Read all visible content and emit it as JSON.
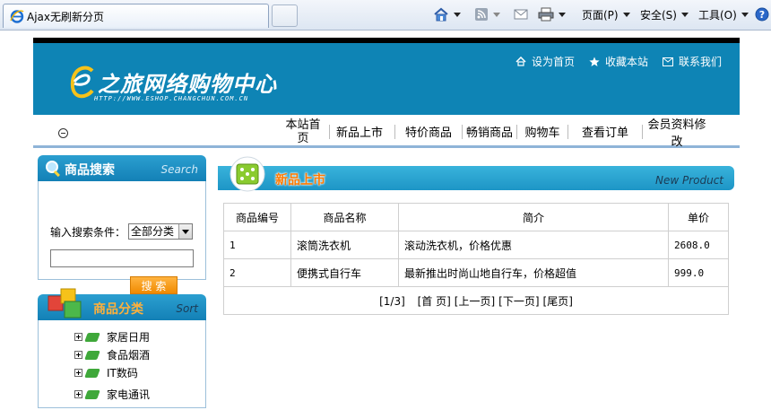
{
  "browser": {
    "tab_title": "Ajax无刷新分页",
    "toolbar": {
      "page_label": "页面(P)",
      "safety_label": "安全(S)",
      "tools_label": "工具(O)"
    }
  },
  "header": {
    "logo_text": "之旅网络购物中心",
    "logo_url": "HTTP://WWW.ESHOP.CHANGCHUN.COM.CN",
    "quick_links": [
      "设为首页",
      "收藏本站",
      "联系我们"
    ]
  },
  "nav": {
    "items": [
      "本站首页",
      "新品上市",
      "特价商品",
      "畅销商品",
      "购物车",
      "查看订单",
      "会员资料修改"
    ]
  },
  "search": {
    "title": "商品搜索",
    "title_en": "Search",
    "label": "输入搜索条件：",
    "select_value": "全部分类",
    "input_value": "",
    "button": "搜 索"
  },
  "categories": {
    "title": "商品分类",
    "title_en": "Sort",
    "items": [
      "家居日用",
      "食品烟酒",
      "IT数码",
      "家电通讯"
    ]
  },
  "products": {
    "title": "新品上市",
    "title_en": "New Product",
    "columns": [
      "商品编号",
      "商品名称",
      "简介",
      "单价"
    ],
    "rows": [
      {
        "id": "1",
        "name": "滚筒洗衣机",
        "desc": "滚动洗衣机，价格优惠",
        "price": "2608.0"
      },
      {
        "id": "2",
        "name": "便携式自行车",
        "desc": "最新推出时尚山地自行车，价格超值",
        "price": "999.0"
      }
    ],
    "pager": {
      "status": "[1/3]",
      "first": "[首 页]",
      "prev": "[上一页]",
      "next": "[下一页]",
      "last": "[尾页]"
    }
  },
  "colors": {
    "banner": "#0e84b5",
    "accent_orange": "#f08a00",
    "header_blue": "#1d95c6"
  }
}
